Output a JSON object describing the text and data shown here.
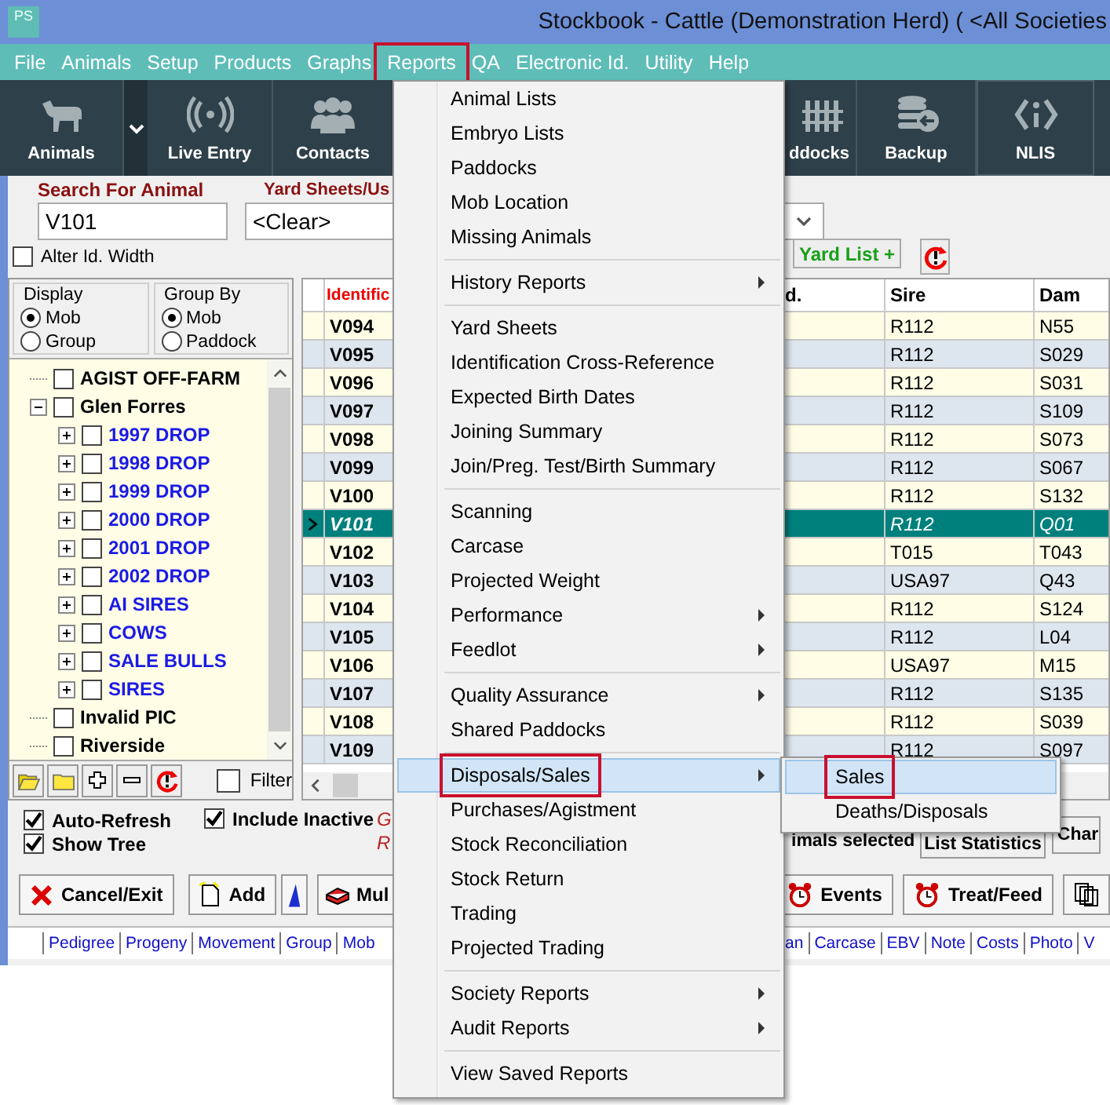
{
  "window": {
    "title": "Stockbook - Cattle (Demonstration Herd) ( <All Societies"
  },
  "app_badge": "PS",
  "menu_bar": [
    {
      "label": "File",
      "highlighted": false
    },
    {
      "label": "Animals",
      "highlighted": false
    },
    {
      "label": "Setup",
      "highlighted": false
    },
    {
      "label": "Products",
      "highlighted": false
    },
    {
      "label": "Graphs",
      "highlighted": false
    },
    {
      "label": "Reports",
      "highlighted": true
    },
    {
      "label": "QA",
      "highlighted": false
    },
    {
      "label": "Electronic Id.",
      "highlighted": false
    },
    {
      "label": "Utility",
      "highlighted": false
    },
    {
      "label": "Help",
      "highlighted": false
    }
  ],
  "toolbar": {
    "left": [
      {
        "label": "Animals",
        "kind": "cow"
      },
      {
        "kind": "dropdown"
      },
      {
        "label": "Live Entry",
        "kind": "signal"
      },
      {
        "label": "Contacts",
        "kind": "people"
      }
    ],
    "right": [
      {
        "label": "ddocks",
        "kind": "fence"
      },
      {
        "label": "Backup",
        "kind": "database"
      },
      {
        "label": "NLIS",
        "kind": "id"
      }
    ]
  },
  "search": {
    "label": "Search For Animal",
    "value": "V101"
  },
  "yard_sheets": {
    "label": "Yard Sheets/Us",
    "value": "<Clear>"
  },
  "yard_list_button": "Yard List +",
  "alter_id_width": {
    "label": "Alter Id. Width",
    "checked": false
  },
  "display": {
    "title": "Display",
    "options": [
      {
        "label": "Mob",
        "selected": true
      },
      {
        "label": "Group",
        "selected": false
      }
    ]
  },
  "group_by": {
    "title": "Group By",
    "options": [
      {
        "label": "Mob",
        "selected": true
      },
      {
        "label": "Paddock",
        "selected": false
      }
    ]
  },
  "tree": [
    {
      "label": "AGIST OFF-FARM",
      "checked": false
    },
    {
      "label": "Glen Forres",
      "checked": false,
      "expanded": true,
      "children": [
        {
          "label": "1997 DROP",
          "checked": false,
          "expanded": false
        },
        {
          "label": "1998 DROP",
          "checked": false,
          "expanded": false
        },
        {
          "label": "1999 DROP",
          "checked": false,
          "expanded": false
        },
        {
          "label": "2000 DROP",
          "checked": false,
          "expanded": false
        },
        {
          "label": "2001 DROP",
          "checked": false,
          "expanded": false
        },
        {
          "label": "2002 DROP",
          "checked": false,
          "expanded": false
        },
        {
          "label": "AI SIRES",
          "checked": false,
          "expanded": false
        },
        {
          "label": "COWS",
          "checked": false,
          "expanded": false
        },
        {
          "label": "SALE BULLS",
          "checked": false,
          "expanded": false
        },
        {
          "label": "SIRES",
          "checked": false,
          "expanded": false
        }
      ]
    },
    {
      "label": "Invalid PIC",
      "checked": false
    },
    {
      "label": "Riverside",
      "checked": false
    }
  ],
  "filter": {
    "label": "Filter",
    "checked": false
  },
  "grid": {
    "columns": [
      {
        "label": "Identific",
        "kind": "id"
      },
      {
        "label": "d.",
        "kind": "mgmt"
      },
      {
        "label": "Sire",
        "kind": "sire"
      },
      {
        "label": "Dam",
        "kind": "dam"
      }
    ],
    "rows": [
      {
        "id": "V094",
        "sire": "R112",
        "dam": "N55",
        "selected": false
      },
      {
        "id": "V095",
        "sire": "R112",
        "dam": "S029",
        "selected": false
      },
      {
        "id": "V096",
        "sire": "R112",
        "dam": "S031",
        "selected": false
      },
      {
        "id": "V097",
        "sire": "R112",
        "dam": "S109",
        "selected": false
      },
      {
        "id": "V098",
        "sire": "R112",
        "dam": "S073",
        "selected": false
      },
      {
        "id": "V099",
        "sire": "R112",
        "dam": "S067",
        "selected": false
      },
      {
        "id": "V100",
        "sire": "R112",
        "dam": "S132",
        "selected": false
      },
      {
        "id": "V101",
        "sire": "R112",
        "dam": "Q01",
        "selected": true
      },
      {
        "id": "V102",
        "sire": "T015",
        "dam": "T043",
        "selected": false
      },
      {
        "id": "V103",
        "sire": "USA97",
        "dam": "Q43",
        "selected": false
      },
      {
        "id": "V104",
        "sire": "R112",
        "dam": "S124",
        "selected": false
      },
      {
        "id": "V105",
        "sire": "R112",
        "dam": "L04",
        "selected": false
      },
      {
        "id": "V106",
        "sire": "USA97",
        "dam": "M15",
        "selected": false
      },
      {
        "id": "V107",
        "sire": "R112",
        "dam": "S135",
        "selected": false
      },
      {
        "id": "V108",
        "sire": "R112",
        "dam": "S039",
        "selected": false
      },
      {
        "id": "V109",
        "sire": "R112",
        "dam": "S097",
        "selected": false
      }
    ]
  },
  "options": [
    {
      "label": "Auto-Refresh",
      "checked": true
    },
    {
      "label": "Show Tree",
      "checked": true
    },
    {
      "label": "Include Inactive",
      "checked": true
    }
  ],
  "status_marks": [
    "G",
    "R"
  ],
  "selection_text": "imals selected",
  "list_buttons": [
    "List Statistics",
    "Char"
  ],
  "action_buttons": {
    "left": [
      {
        "label": "Cancel/Exit",
        "kind": "cancel"
      },
      {
        "label": "Add",
        "kind": "add"
      },
      {
        "kind": "flag"
      },
      {
        "label": "Mul",
        "kind": "multi"
      }
    ],
    "right": [
      {
        "label": "Events",
        "kind": "alarm"
      },
      {
        "label": "Treat/Feed",
        "kind": "alarm"
      },
      {
        "kind": "pages"
      }
    ]
  },
  "links": {
    "left": [
      "Pedigree",
      "Progeny",
      "Movement",
      "Group",
      "Mob"
    ],
    "right": [
      "an",
      "Carcase",
      "EBV",
      "Note",
      "Costs",
      "Photo",
      "V"
    ]
  },
  "reports_menu": [
    {
      "kind": "item",
      "label": "Animal Lists",
      "submenu": false,
      "selected": false,
      "highlighted": false
    },
    {
      "kind": "item",
      "label": "Embryo Lists",
      "submenu": false,
      "selected": false,
      "highlighted": false
    },
    {
      "kind": "item",
      "label": "Paddocks",
      "submenu": false,
      "selected": false,
      "highlighted": false
    },
    {
      "kind": "item",
      "label": "Mob Location",
      "submenu": false,
      "selected": false,
      "highlighted": false
    },
    {
      "kind": "item",
      "label": "Missing Animals",
      "submenu": false,
      "selected": false,
      "highlighted": false
    },
    {
      "kind": "separator"
    },
    {
      "kind": "item",
      "label": "History Reports",
      "submenu": true,
      "selected": false,
      "highlighted": false
    },
    {
      "kind": "separator"
    },
    {
      "kind": "item",
      "label": "Yard Sheets",
      "submenu": false,
      "selected": false,
      "highlighted": false
    },
    {
      "kind": "item",
      "label": "Identification Cross-Reference",
      "submenu": false,
      "selected": false,
      "highlighted": false
    },
    {
      "kind": "item",
      "label": "Expected Birth Dates",
      "submenu": false,
      "selected": false,
      "highlighted": false
    },
    {
      "kind": "item",
      "label": "Joining Summary",
      "submenu": false,
      "selected": false,
      "highlighted": false
    },
    {
      "kind": "item",
      "label": "Join/Preg. Test/Birth Summary",
      "submenu": false,
      "selected": false,
      "highlighted": false
    },
    {
      "kind": "separator"
    },
    {
      "kind": "item",
      "label": "Scanning",
      "submenu": false,
      "selected": false,
      "highlighted": false
    },
    {
      "kind": "item",
      "label": "Carcase",
      "submenu": false,
      "selected": false,
      "highlighted": false
    },
    {
      "kind": "item",
      "label": "Projected Weight",
      "submenu": false,
      "selected": false,
      "highlighted": false
    },
    {
      "kind": "item",
      "label": "Performance",
      "submenu": true,
      "selected": false,
      "highlighted": false
    },
    {
      "kind": "item",
      "label": "Feedlot",
      "submenu": true,
      "selected": false,
      "highlighted": false
    },
    {
      "kind": "separator"
    },
    {
      "kind": "item",
      "label": "Quality Assurance",
      "submenu": true,
      "selected": false,
      "highlighted": false
    },
    {
      "kind": "item",
      "label": "Shared Paddocks",
      "submenu": false,
      "selected": false,
      "highlighted": false
    },
    {
      "kind": "separator"
    },
    {
      "kind": "item",
      "label": "Disposals/Sales",
      "submenu": true,
      "selected": true,
      "highlighted": true
    },
    {
      "kind": "item",
      "label": "Purchases/Agistment",
      "submenu": false,
      "selected": false,
      "highlighted": false
    },
    {
      "kind": "item",
      "label": "Stock Reconciliation",
      "submenu": false,
      "selected": false,
      "highlighted": false
    },
    {
      "kind": "item",
      "label": "Stock Return",
      "submenu": false,
      "selected": false,
      "highlighted": false
    },
    {
      "kind": "item",
      "label": "Trading",
      "submenu": false,
      "selected": false,
      "highlighted": false
    },
    {
      "kind": "item",
      "label": "Projected Trading",
      "submenu": false,
      "selected": false,
      "highlighted": false
    },
    {
      "kind": "separator"
    },
    {
      "kind": "item",
      "label": "Society Reports",
      "submenu": true,
      "selected": false,
      "highlighted": false
    },
    {
      "kind": "item",
      "label": "Audit Reports",
      "submenu": true,
      "selected": false,
      "highlighted": false
    },
    {
      "kind": "separator"
    },
    {
      "kind": "item",
      "label": "View Saved Reports",
      "submenu": false,
      "selected": false,
      "highlighted": false
    }
  ],
  "disposals_submenu": [
    {
      "label": "Sales",
      "selected": true,
      "highlighted": true
    },
    {
      "label": "Deaths/Disposals",
      "selected": false,
      "highlighted": false
    }
  ]
}
